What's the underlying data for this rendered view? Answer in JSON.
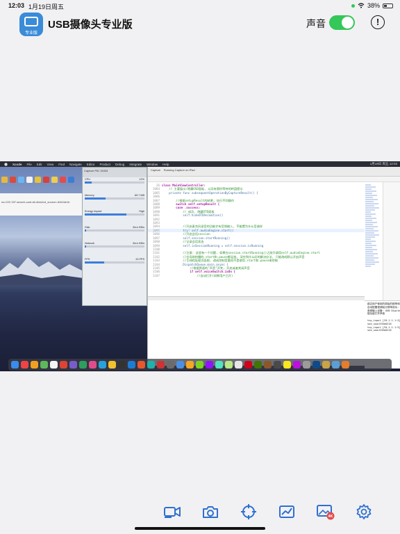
{
  "status_bar": {
    "time": "12:03",
    "date": "1月19日周五",
    "battery": "38%"
  },
  "app": {
    "title": "USB摄像头专业版",
    "logo_label": "专业版",
    "sound_label": "声音",
    "sound_on": true,
    "accent_color": "#34c759",
    "brand_color": "#3a8bd8"
  },
  "video_frame": {
    "mac_menu": [
      "Xcode",
      "File",
      "Edit",
      "View",
      "Find",
      "Navigate",
      "Editor",
      "Product",
      "Debug",
      "Integrate",
      "Window",
      "Help"
    ],
    "mac_clock": "1月19日 周五 12:03",
    "browser_url": "ns=222.337.search-card.all.click&vd_source=d1b0de1b",
    "capture_window": {
      "title": "Capture",
      "pid": "PID 15333",
      "rows": [
        {
          "label": "CPU",
          "value": "12%",
          "fill": 0.12
        },
        {
          "label": "Memory",
          "value": "69.7 MB",
          "fill": 0.35
        },
        {
          "label": "Energy Impact",
          "value": "High",
          "fill": 0.7
        },
        {
          "label": "Disk",
          "value": "Zero KB/s",
          "fill": 0.02
        },
        {
          "label": "Network",
          "value": "Zero KB/s",
          "fill": 0.02
        },
        {
          "label": "FPS",
          "value": "20 FPS",
          "fill": 0.33
        }
      ]
    },
    "xcode": {
      "scheme": "Capture",
      "device": "Running Capture on iPad",
      "code_lines": [
        {
          "n": "26",
          "text": "class MainViewController:",
          "cls": "kw"
        },
        {
          "n": "1084",
          "text": "    // 主要展示/隐藏OSD面板, 以及有图时等待的转盘提示",
          "cls": "cm"
        },
        {
          "n": "1085",
          "text": "    private func subsequentOperationByCaptureResult() {",
          "cls": "fn"
        },
        {
          "n": "1086",
          "text": "",
          "cls": ""
        },
        {
          "n": "1087",
          "text": "        //根据setupResult的结果, 执行不同操作",
          "cls": "cm"
        },
        {
          "n": "1088",
          "text": "        switch self.setupResult {",
          "cls": "kw"
        },
        {
          "n": "1089",
          "text": "        case .success:",
          "cls": "kw"
        },
        {
          "n": "1090",
          "text": "            // 成功, 隐藏OTD面板",
          "cls": "cm"
        },
        {
          "n": "1091",
          "text": "            self.hideOTDAnimation()",
          "cls": "fn"
        },
        {
          "n": "1092",
          "text": "",
          "cls": ""
        },
        {
          "n": "1093",
          "text": "",
          "cls": ""
        },
        {
          "n": "1094",
          "text": "            //开启麦克风录音的功能才有音频输入, 不能置为什么音谱样",
          "cls": "cm"
        },
        {
          "n": "1095",
          "text": "            try! self.audioEngine.start()",
          "cls": "hl"
        },
        {
          "n": "1096",
          "text": "            //开启会话session",
          "cls": "cm"
        },
        {
          "n": "1097",
          "text": "            self.session.startRunning()",
          "cls": "fn"
        },
        {
          "n": "1098",
          "text": "            //记录会话状态",
          "cls": "cm"
        },
        {
          "n": "1099",
          "text": "            self.isSessionRunning = self.session.isRunning",
          "cls": "fn"
        },
        {
          "n": "1100",
          "text": "",
          "cls": ""
        },
        {
          "n": "1101",
          "text": "            //注意: 这里有一个问题, 如果在session.startRunning()之前开调用self.audioEngine.start",
          "cls": "cm"
        },
        {
          "n": "1102",
          "text": "            //会导致拍摄的.start和.pause都无效, 深究到什么好的解决办法, 只能改成默认开启声音",
          "cls": "cm"
        },
        {
          "n": "1103",
          "text": "            //主线程处理页面图, 改成控制音量而不是使用.start和.pause来控制",
          "cls": "cm"
        },
        {
          "n": "1104",
          "text": "            DispatchQueue.main.async {",
          "cls": "fn"
        },
        {
          "n": "1105",
          "text": "                //根据界面的\"声音\"开关, 开启或者关闭声音",
          "cls": "cm"
        },
        {
          "n": "1106",
          "text": "                if self.voiceSwitch.isOn {",
          "cls": "kw"
        },
        {
          "n": "1107",
          "text": "                    //自动打开(如果用户已开)",
          "cls": "cm"
        }
      ],
      "console_lines": [
        "越过用户使用的原始的频率和分辨率 -- 1920 - 1080 - 60",
        "自动配置视频帧分辨率成功: 60 -- 1920 -- 1080",
        "音频输入设备: USB Digital Audio",
        "能功能打开声音",
        "",
        "tcp_input [C0.1.1.1:3] flags=[R] seq=4009A4670, ack=0, win=0 state=LAST_ACK rcv_nxt=4009A4670,",
        "snd_una=535e6216",
        "tcp_input [C0.1.1.1:3] flags=[R] seq=4009A4670, ack=0, win=0 state=CLOSED rcv_nxt=4009A4670,",
        "snd_una=535e6216"
      ]
    }
  },
  "toolbar": {
    "buttons": [
      {
        "name": "record-button",
        "icon": "video-camera-icon"
      },
      {
        "name": "snapshot-button",
        "icon": "camera-icon"
      },
      {
        "name": "crosshair-button",
        "icon": "crosshair-icon"
      },
      {
        "name": "stats-button",
        "icon": "chart-line-icon"
      },
      {
        "name": "gallery-button",
        "icon": "photo-library-icon",
        "badge": "4K"
      },
      {
        "name": "settings-button",
        "icon": "gear-icon"
      }
    ],
    "icon_color": "#2f6fd0"
  }
}
